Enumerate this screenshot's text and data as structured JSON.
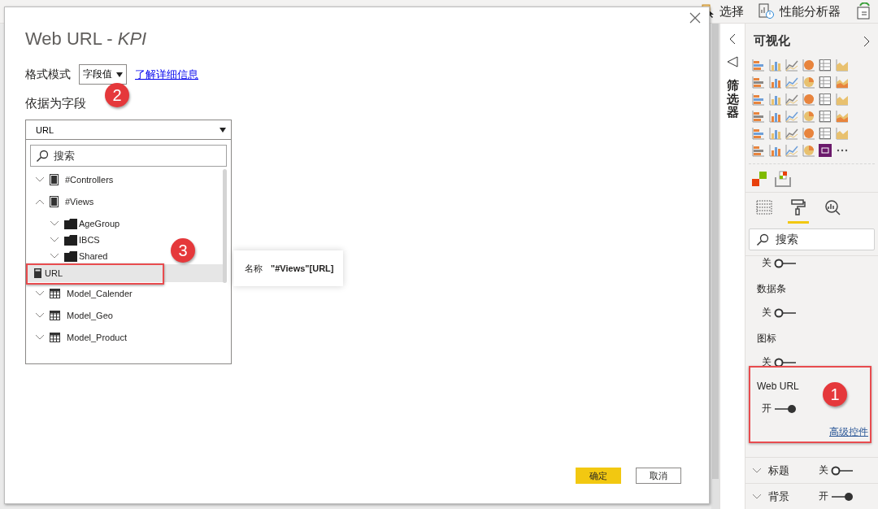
{
  "toolbar": {
    "items": [
      {
        "kind": "select",
        "label": "选择"
      },
      {
        "kind": "performance",
        "label": "性能分析器"
      },
      {
        "kind": "refresh"
      }
    ]
  },
  "dialog": {
    "title": "Web URL - *KPI*",
    "format_mode": {
      "label": "格式模式",
      "value": "字段值",
      "link": "了解详细信息"
    },
    "field_heading": "依据为字段",
    "field_dropdown": {
      "value": "URL"
    },
    "field_search": {
      "placeholder": "搜索"
    },
    "field_tree": [
      {
        "kind": "measure-table",
        "label": "#Controllers",
        "expanded": false,
        "selected": false
      },
      {
        "kind": "measure-table",
        "label": "#Views",
        "expanded": true,
        "selected": false,
        "children": [
          {
            "kind": "folder",
            "label": "AgeGroup",
            "expanded": false,
            "selected": false
          },
          {
            "kind": "folder",
            "label": "IBCS",
            "expanded": false,
            "selected": false
          },
          {
            "kind": "folder",
            "label": "Shared",
            "expanded": false,
            "selected": false
          },
          {
            "kind": "measure",
            "label": "URL",
            "selected": true
          }
        ]
      },
      {
        "kind": "table",
        "label": "Model_Calender",
        "expanded": false,
        "selected": false
      },
      {
        "kind": "table",
        "label": "Model_Geo",
        "expanded": false,
        "selected": false
      },
      {
        "kind": "table",
        "label": "Model_Product",
        "expanded": false,
        "selected": false
      }
    ],
    "tooltip": {
      "key": "名称",
      "value": "\"#Views\"[URL]"
    },
    "buttons": [
      {
        "kind": "primary",
        "label": "确定"
      },
      {
        "kind": "secondary",
        "label": "取消"
      }
    ]
  },
  "filters_pane": {
    "title": "筛选器"
  },
  "visualizations": {
    "title": "可视化",
    "tabs": [
      {
        "kind": "fields",
        "selected": false
      },
      {
        "kind": "format",
        "selected": true
      },
      {
        "kind": "analytics",
        "selected": false
      }
    ],
    "search": {
      "placeholder": "搜索"
    },
    "cards": [
      {
        "state_label": "关",
        "on": false
      },
      {
        "title": "数据条",
        "state_label": "关",
        "on": false
      },
      {
        "title": "图标",
        "state_label": "关",
        "on": false
      },
      {
        "title": "Web URL",
        "state_label": "开",
        "on": true,
        "link": "高级控件"
      }
    ],
    "sections": [
      {
        "title": "标题",
        "expanded": false,
        "state_label": "关",
        "on": false
      },
      {
        "title": "背景",
        "expanded": false,
        "state_label": "开",
        "on": true
      }
    ]
  },
  "callouts": [
    {
      "number": "2"
    },
    {
      "number": "3"
    },
    {
      "number": "1"
    }
  ]
}
